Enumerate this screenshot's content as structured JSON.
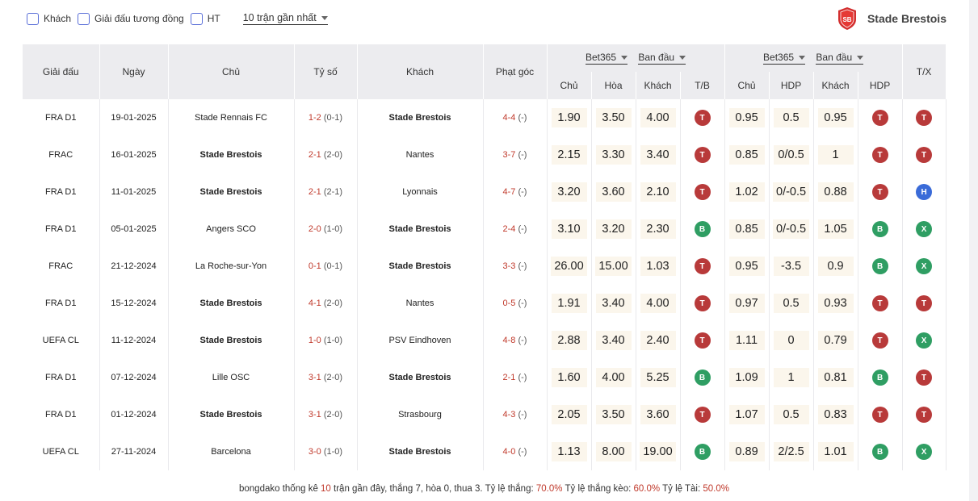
{
  "filters": {
    "items": [
      {
        "label": "Khách"
      },
      {
        "label": "Giải đấu tương đồng"
      },
      {
        "label": "HT"
      }
    ],
    "select_value": "10 trận gần nhất"
  },
  "team": {
    "name": "Stade Brestois",
    "logo_text": "SB"
  },
  "headers": {
    "league": "Giải đấu",
    "date": "Ngày",
    "home": "Chủ",
    "score": "Tỷ số",
    "away": "Khách",
    "corner": "Phạt góc",
    "group1": {
      "bookmaker": "Bet365",
      "type": "Ban đầu"
    },
    "group2": {
      "bookmaker": "Bet365",
      "type": "Ban đầu"
    },
    "sub1": [
      "Chủ",
      "Hòa",
      "Khách",
      "T/B"
    ],
    "sub2": [
      "Chủ",
      "HDP",
      "Khách",
      "HDP"
    ],
    "tx": "T/X"
  },
  "rows": [
    {
      "league": "FRA D1",
      "date": "19-01-2025",
      "home": "Stade Rennais FC",
      "home_bold": false,
      "score": "1-2",
      "ht": "(0-1)",
      "away": "Stade Brestois",
      "away_bold": true,
      "corner": "4-4",
      "corner_ht": "(-)",
      "o1": "1.90",
      "o2": "3.50",
      "o3": "4.00",
      "tb": "T",
      "h1": "0.95",
      "hdp": "0.5",
      "h2": "0.95",
      "hdpr": "T",
      "tx": "T"
    },
    {
      "league": "FRAC",
      "date": "16-01-2025",
      "home": "Stade Brestois",
      "home_bold": true,
      "score": "2-1",
      "ht": "(2-0)",
      "away": "Nantes",
      "away_bold": false,
      "corner": "3-7",
      "corner_ht": "(-)",
      "o1": "2.15",
      "o2": "3.30",
      "o3": "3.40",
      "tb": "T",
      "h1": "0.85",
      "hdp": "0/0.5",
      "h2": "1",
      "hdpr": "T",
      "tx": "T"
    },
    {
      "league": "FRA D1",
      "date": "11-01-2025",
      "home": "Stade Brestois",
      "home_bold": true,
      "score": "2-1",
      "ht": "(2-1)",
      "away": "Lyonnais",
      "away_bold": false,
      "corner": "4-7",
      "corner_ht": "(-)",
      "o1": "3.20",
      "o2": "3.60",
      "o3": "2.10",
      "tb": "T",
      "h1": "1.02",
      "hdp": "0/-0.5",
      "h2": "0.88",
      "hdpr": "T",
      "tx": "H"
    },
    {
      "league": "FRA D1",
      "date": "05-01-2025",
      "home": "Angers SCO",
      "home_bold": false,
      "score": "2-0",
      "ht": "(1-0)",
      "away": "Stade Brestois",
      "away_bold": true,
      "corner": "2-4",
      "corner_ht": "(-)",
      "o1": "3.10",
      "o2": "3.20",
      "o3": "2.30",
      "tb": "B",
      "h1": "0.85",
      "hdp": "0/-0.5",
      "h2": "1.05",
      "hdpr": "B",
      "tx": "X"
    },
    {
      "league": "FRAC",
      "date": "21-12-2024",
      "home": "La Roche-sur-Yon",
      "home_bold": false,
      "score": "0-1",
      "ht": "(0-1)",
      "away": "Stade Brestois",
      "away_bold": true,
      "corner": "3-3",
      "corner_ht": "(-)",
      "o1": "26.00",
      "o2": "15.00",
      "o3": "1.03",
      "tb": "T",
      "h1": "0.95",
      "hdp": "-3.5",
      "h2": "0.9",
      "hdpr": "B",
      "tx": "X"
    },
    {
      "league": "FRA D1",
      "date": "15-12-2024",
      "home": "Stade Brestois",
      "home_bold": true,
      "score": "4-1",
      "ht": "(2-0)",
      "away": "Nantes",
      "away_bold": false,
      "corner": "0-5",
      "corner_ht": "(-)",
      "o1": "1.91",
      "o2": "3.40",
      "o3": "4.00",
      "tb": "T",
      "h1": "0.97",
      "hdp": "0.5",
      "h2": "0.93",
      "hdpr": "T",
      "tx": "T"
    },
    {
      "league": "UEFA CL",
      "date": "11-12-2024",
      "home": "Stade Brestois",
      "home_bold": true,
      "score": "1-0",
      "ht": "(1-0)",
      "away": "PSV Eindhoven",
      "away_bold": false,
      "corner": "4-8",
      "corner_ht": "(-)",
      "o1": "2.88",
      "o2": "3.40",
      "o3": "2.40",
      "tb": "T",
      "h1": "1.11",
      "hdp": "0",
      "h2": "0.79",
      "hdpr": "T",
      "tx": "X"
    },
    {
      "league": "FRA D1",
      "date": "07-12-2024",
      "home": "Lille OSC",
      "home_bold": false,
      "score": "3-1",
      "ht": "(2-0)",
      "away": "Stade Brestois",
      "away_bold": true,
      "corner": "2-1",
      "corner_ht": "(-)",
      "o1": "1.60",
      "o2": "4.00",
      "o3": "5.25",
      "tb": "B",
      "h1": "1.09",
      "hdp": "1",
      "h2": "0.81",
      "hdpr": "B",
      "tx": "T"
    },
    {
      "league": "FRA D1",
      "date": "01-12-2024",
      "home": "Stade Brestois",
      "home_bold": true,
      "score": "3-1",
      "ht": "(2-0)",
      "away": "Strasbourg",
      "away_bold": false,
      "corner": "4-3",
      "corner_ht": "(-)",
      "o1": "2.05",
      "o2": "3.50",
      "o3": "3.60",
      "tb": "T",
      "h1": "1.07",
      "hdp": "0.5",
      "h2": "0.83",
      "hdpr": "T",
      "tx": "T"
    },
    {
      "league": "UEFA CL",
      "date": "27-11-2024",
      "home": "Barcelona",
      "home_bold": false,
      "score": "3-0",
      "ht": "(1-0)",
      "away": "Stade Brestois",
      "away_bold": true,
      "corner": "4-0",
      "corner_ht": "(-)",
      "o1": "1.13",
      "o2": "8.00",
      "o3": "19.00",
      "tb": "B",
      "h1": "0.89",
      "hdp": "2/2.5",
      "h2": "1.01",
      "hdpr": "B",
      "tx": "X"
    }
  ],
  "footer": {
    "p1": "bongdako thống kê ",
    "n_matches": "10",
    "p2": " trận gần đây, thắng 7, hòa 0, thua 3. Tỷ lệ thắng: ",
    "win_rate": "70.0%",
    "p3": " Tỷ lệ thắng kèo: ",
    "hdp_rate": "60.0%",
    "p4": " Tỷ lệ Tài: ",
    "over_rate": "50.0%"
  },
  "colors": {
    "red": "#c0392b",
    "green": "#2f9e63",
    "blue": "#3a6bd8",
    "header_bg": "#ececef"
  }
}
